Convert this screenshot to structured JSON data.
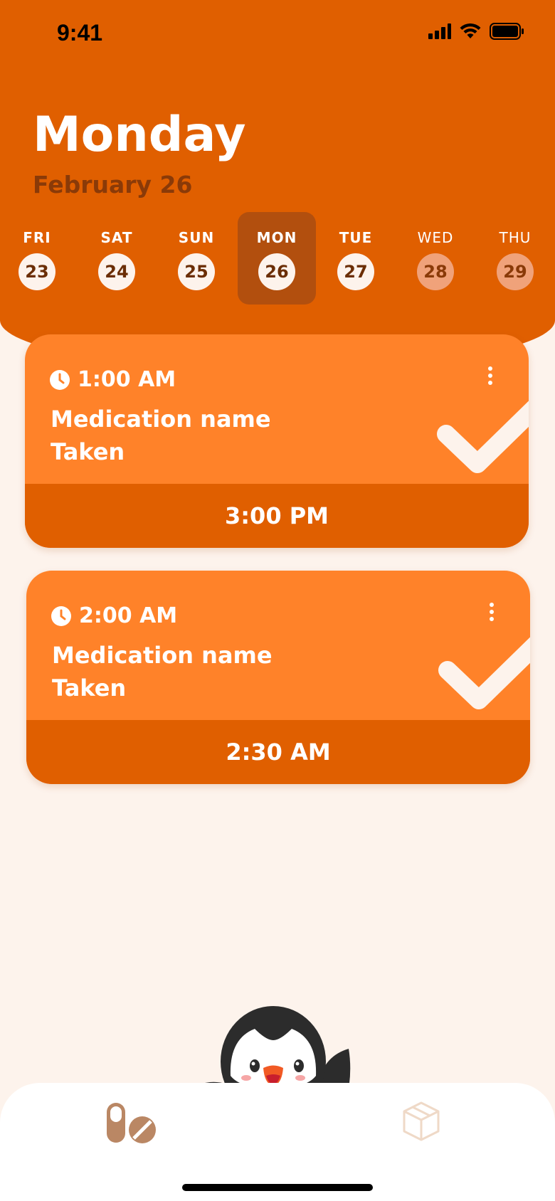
{
  "status_bar": {
    "time": "9:41"
  },
  "header": {
    "day": "Monday",
    "date": "February 26"
  },
  "week": [
    {
      "name": "FRI",
      "num": "23",
      "state": "past"
    },
    {
      "name": "SAT",
      "num": "24",
      "state": "past"
    },
    {
      "name": "SUN",
      "num": "25",
      "state": "past"
    },
    {
      "name": "MON",
      "num": "26",
      "state": "selected"
    },
    {
      "name": "TUE",
      "num": "27",
      "state": "past"
    },
    {
      "name": "WED",
      "num": "28",
      "state": "future"
    },
    {
      "name": "THU",
      "num": "29",
      "state": "future"
    }
  ],
  "doses": [
    {
      "time": "1:00 AM",
      "name": "Medication name",
      "status": "Taken",
      "taken_at": "3:00 PM"
    },
    {
      "time": "2:00 AM",
      "name": "Medication name",
      "status": "Taken",
      "taken_at": "2:30 AM"
    }
  ],
  "tabbar": {
    "tabs": [
      {
        "icon": "pills-icon",
        "active": true
      },
      {
        "icon": "box-icon",
        "active": false
      }
    ]
  },
  "colors": {
    "header": "#E05F00",
    "card": "#FF8229",
    "card_footer": "#E05F00",
    "selected_day": "#B24F0E",
    "background": "#FDF3EC",
    "accent_text": "#8A3A08"
  }
}
